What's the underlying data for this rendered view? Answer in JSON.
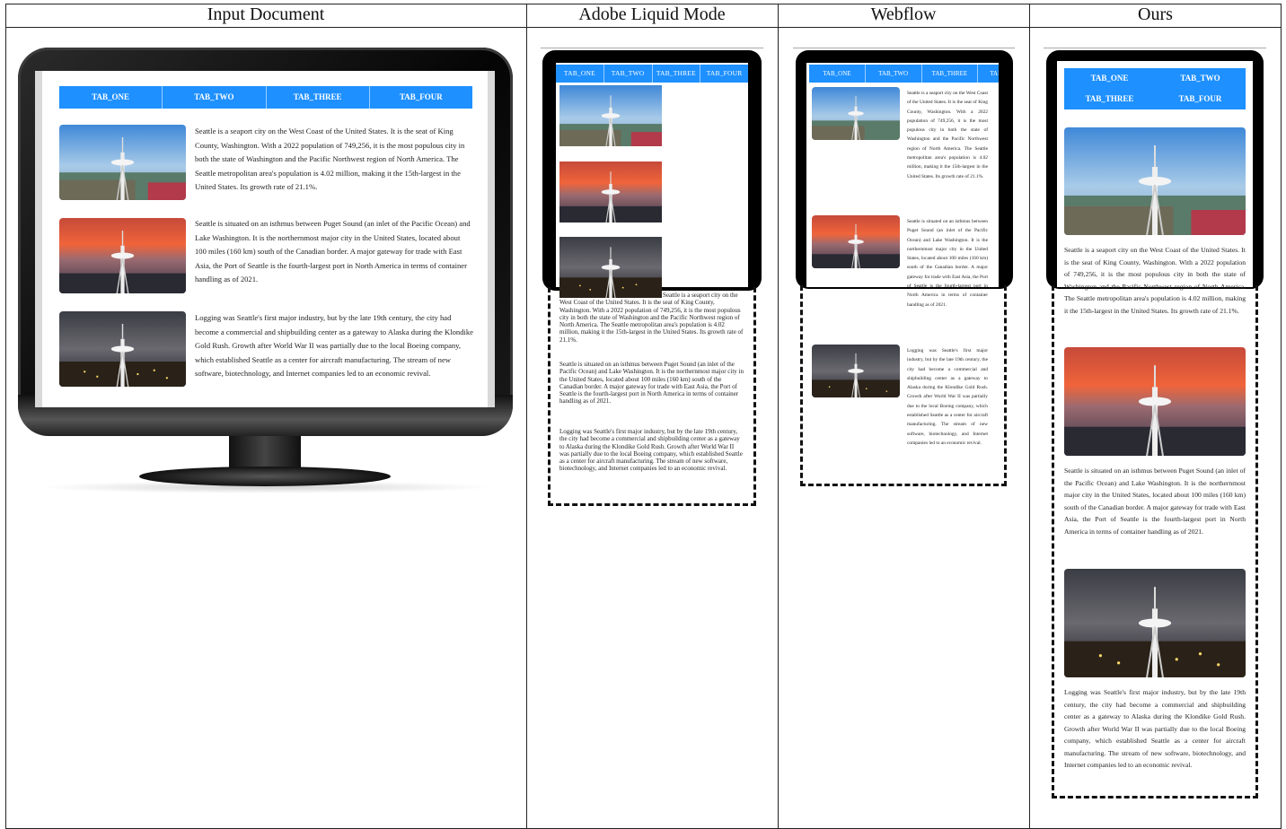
{
  "columns": [
    "Input Document",
    "Adobe Liquid Mode",
    "Webflow",
    "Ours"
  ],
  "tabs": [
    "TAB_ONE",
    "TAB_TWO",
    "TAB_THREE",
    "TAB_FOUR"
  ],
  "paragraphs": [
    "Seattle is a seaport city on the West Coast of the United States. It is the seat of King County, Washington. With a 2022 population of 749,256, it is the most populous city in both the state of Washington and the Pacific Northwest region of North America. The Seattle metropolitan area's population is 4.02 million, making it the 15th-largest in the United States. Its growth rate of 21.1%.",
    "Seattle is situated on an isthmus between Puget Sound (an inlet of the Pacific Ocean) and Lake Washington. It is the northernmost major city in the United States, located about 100 miles (160 km) south of the Canadian border. A major gateway for trade with East Asia, the Port of Seattle is the fourth-largest port in North America in terms of container handling as of 2021.",
    "Logging was Seattle's first major industry, but by the late 19th century, the city had become a commercial and shipbuilding center as a gateway to Alaska during the Klondike Gold Rush. Growth after World War II was partially due to the local Boeing company, which established Seattle as a center for aircraft manufacturing. The stream of new software, biotechnology, and Internet companies led to an economic revival."
  ],
  "photos": [
    "day-skyline-photo",
    "sunset-skyline-photo",
    "night-skyline-photo"
  ]
}
